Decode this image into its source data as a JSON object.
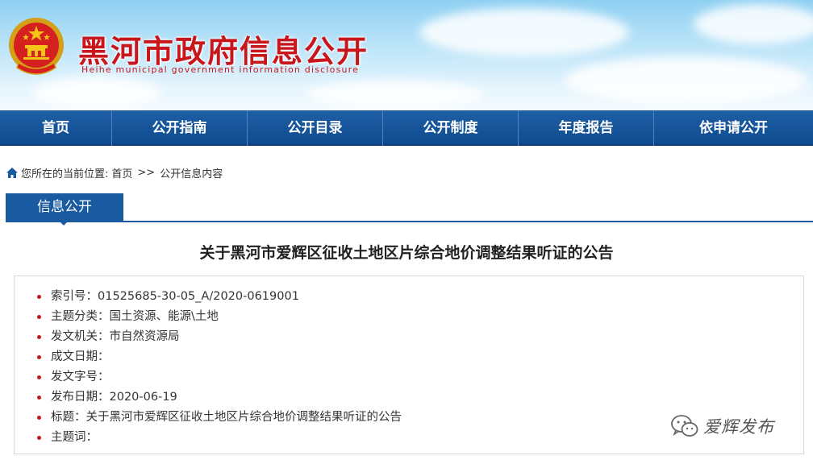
{
  "header": {
    "site_title": "黑河市政府信息公开",
    "site_subtitle": "Heihe municipal government information disclosure"
  },
  "nav": {
    "items": [
      {
        "label": "首页"
      },
      {
        "label": "公开指南"
      },
      {
        "label": "公开目录"
      },
      {
        "label": "公开制度"
      },
      {
        "label": "年度报告"
      },
      {
        "label": "依申请公开"
      }
    ]
  },
  "breadcrumb": {
    "prefix": "您所在的当前位置:",
    "home": "首页",
    "separator": ">>",
    "current": "公开信息内容"
  },
  "section": {
    "tab_label": "信息公开"
  },
  "article": {
    "title": "关于黑河市爱辉区征收土地区片综合地价调整结果听证的公告",
    "meta": [
      {
        "label": "索引号：",
        "value": "01525685-30-05_A/2020-0619001"
      },
      {
        "label": "主题分类：",
        "value": "国土资源、能源\\土地"
      },
      {
        "label": "发文机关：",
        "value": "市自然资源局"
      },
      {
        "label": "成文日期：",
        "value": ""
      },
      {
        "label": "发文字号：",
        "value": ""
      },
      {
        "label": "发布日期：",
        "value": "2020-06-19"
      },
      {
        "label": "标题：",
        "value": "关于黑河市爱辉区征收土地区片综合地价调整结果听证的公告"
      },
      {
        "label": "主题词：",
        "value": ""
      }
    ]
  },
  "watermark": {
    "text": "爱辉发布"
  },
  "colors": {
    "brand_red": "#c8161d",
    "nav_blue": "#1a5aa0"
  }
}
